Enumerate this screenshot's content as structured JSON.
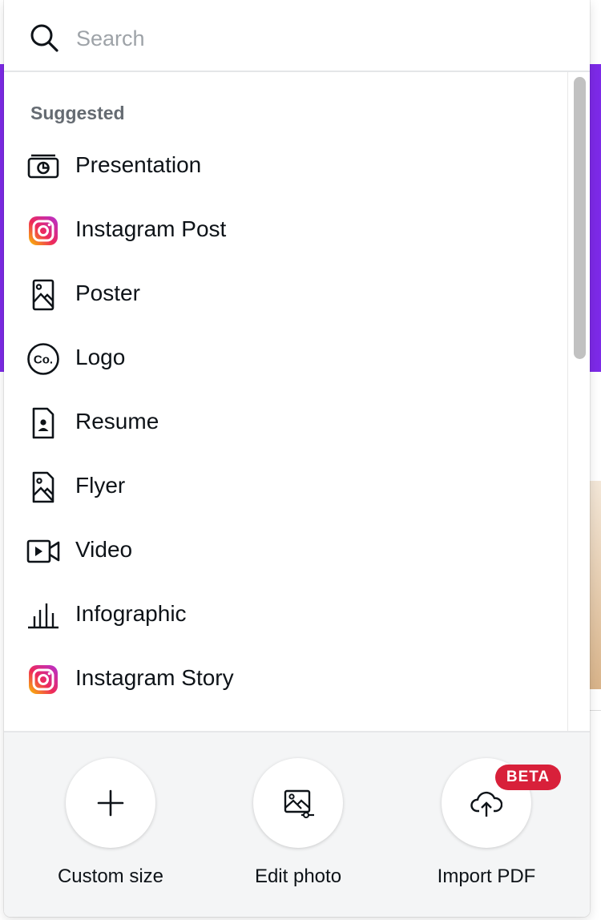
{
  "search": {
    "placeholder": "Search",
    "value": ""
  },
  "list": {
    "section_label": "Suggested",
    "items": [
      {
        "label": "Presentation",
        "icon": "presentation-icon"
      },
      {
        "label": "Instagram Post",
        "icon": "instagram-icon"
      },
      {
        "label": "Poster",
        "icon": "poster-icon"
      },
      {
        "label": "Logo",
        "icon": "logo-icon"
      },
      {
        "label": "Resume",
        "icon": "resume-icon"
      },
      {
        "label": "Flyer",
        "icon": "flyer-icon"
      },
      {
        "label": "Video",
        "icon": "video-icon"
      },
      {
        "label": "Infographic",
        "icon": "infographic-icon"
      },
      {
        "label": "Instagram Story",
        "icon": "instagram-icon"
      }
    ]
  },
  "logo_icon_text": "Co.",
  "footer": {
    "actions": [
      {
        "label": "Custom size",
        "icon": "plus-icon"
      },
      {
        "label": "Edit photo",
        "icon": "edit-photo-icon"
      },
      {
        "label": "Import PDF",
        "icon": "cloud-upload-icon"
      }
    ],
    "beta_badge": "BETA"
  },
  "colors": {
    "brand_purple": "#7d2ae8",
    "beta_red": "#d8203a",
    "text": "#0e1318",
    "muted": "#656b72",
    "placeholder": "#9ea3a8"
  }
}
